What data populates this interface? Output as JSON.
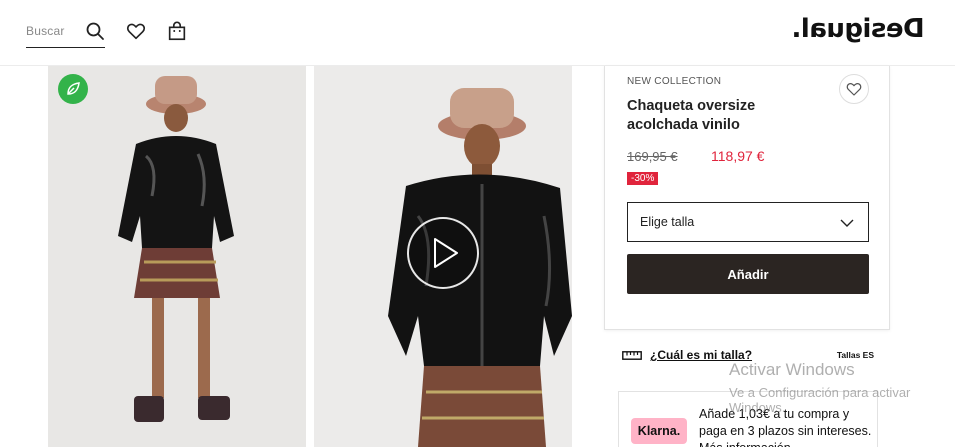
{
  "header": {
    "search_placeholder": "Buscar",
    "logo_text": "Desigual."
  },
  "gallery": {
    "eco_badge_icon": "leaf-icon",
    "video_icon": "play-icon"
  },
  "product": {
    "collection_label": "NEW COLLECTION",
    "title": "Chaqueta oversize acolchada vinilo",
    "old_price": "169,95 €",
    "new_price": "118,97 €",
    "discount": "-30%",
    "size_select_label": "Elige talla",
    "add_button": "Añadir",
    "accent_color": "#e0243c",
    "button_color": "#2b2522"
  },
  "size_guide": {
    "link": "¿Cuál es mi talla?",
    "region": "Tallas ES"
  },
  "klarna": {
    "logo": "Klarna.",
    "text": "Añade 1,03€ a tu compra y paga en 3 plazos sin intereses. Más información"
  },
  "watermark": {
    "title": "Activar Windows",
    "subtitle": "Ve a Configuración para activar Windows."
  }
}
